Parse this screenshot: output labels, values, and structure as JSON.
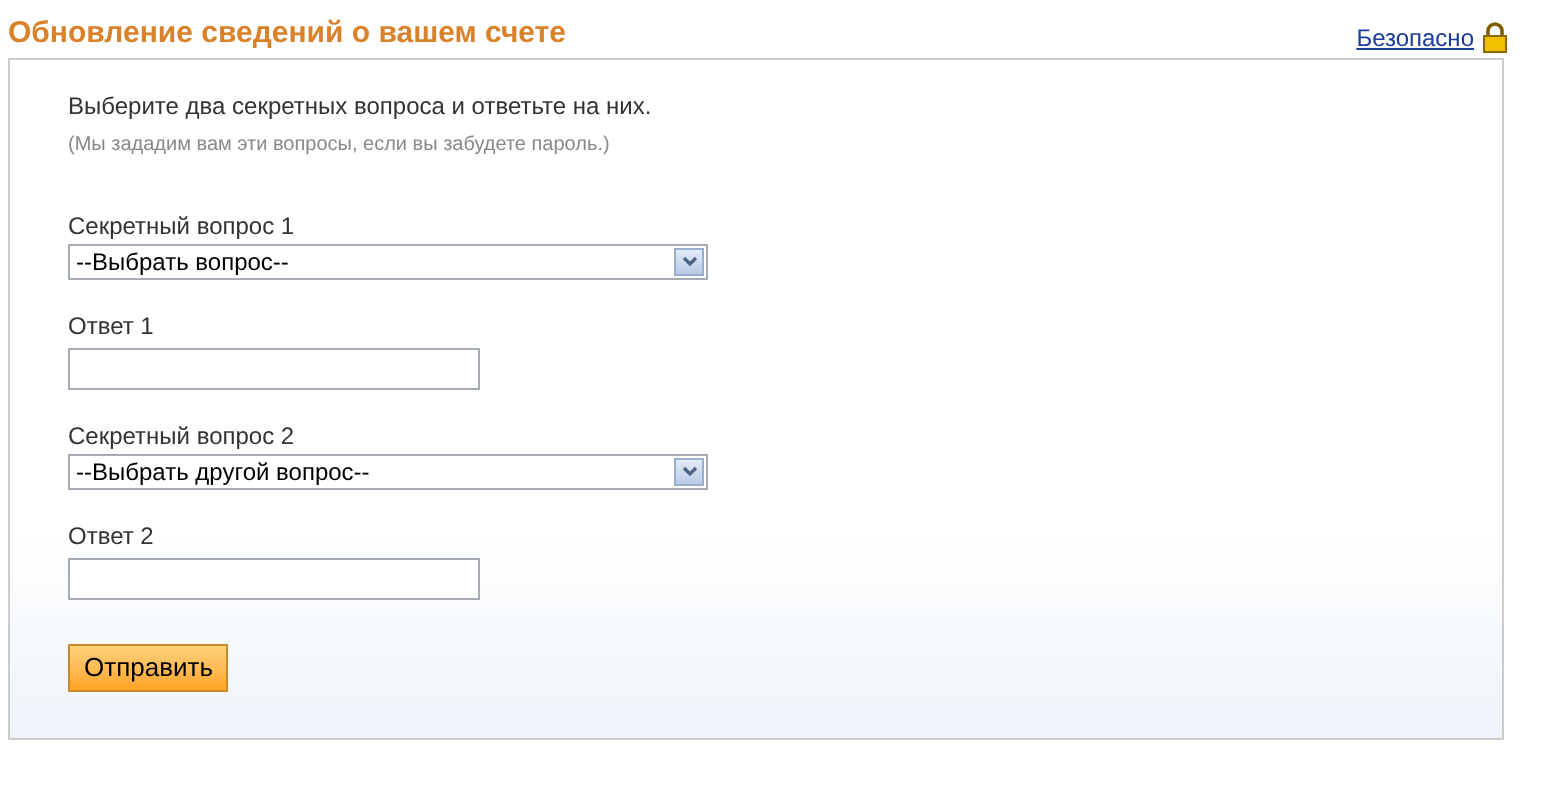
{
  "title": "Обновление сведений о вашем счете",
  "secure_link": "Безопасно",
  "intro": "Выберите два секретных вопроса и ответьте на них.",
  "hint": "(Мы зададим вам эти вопросы, если вы забудете пароль.)",
  "fields": [
    {
      "kind": "select",
      "label": "Секретный вопрос 1",
      "value": "--Выбрать вопрос--"
    },
    {
      "kind": "input",
      "label": "Ответ 1"
    },
    {
      "kind": "select",
      "label": "Секретный вопрос 2",
      "value": "--Выбрать другой вопрос--"
    },
    {
      "kind": "input",
      "label": "Ответ 2"
    }
  ],
  "submit": "Отправить"
}
